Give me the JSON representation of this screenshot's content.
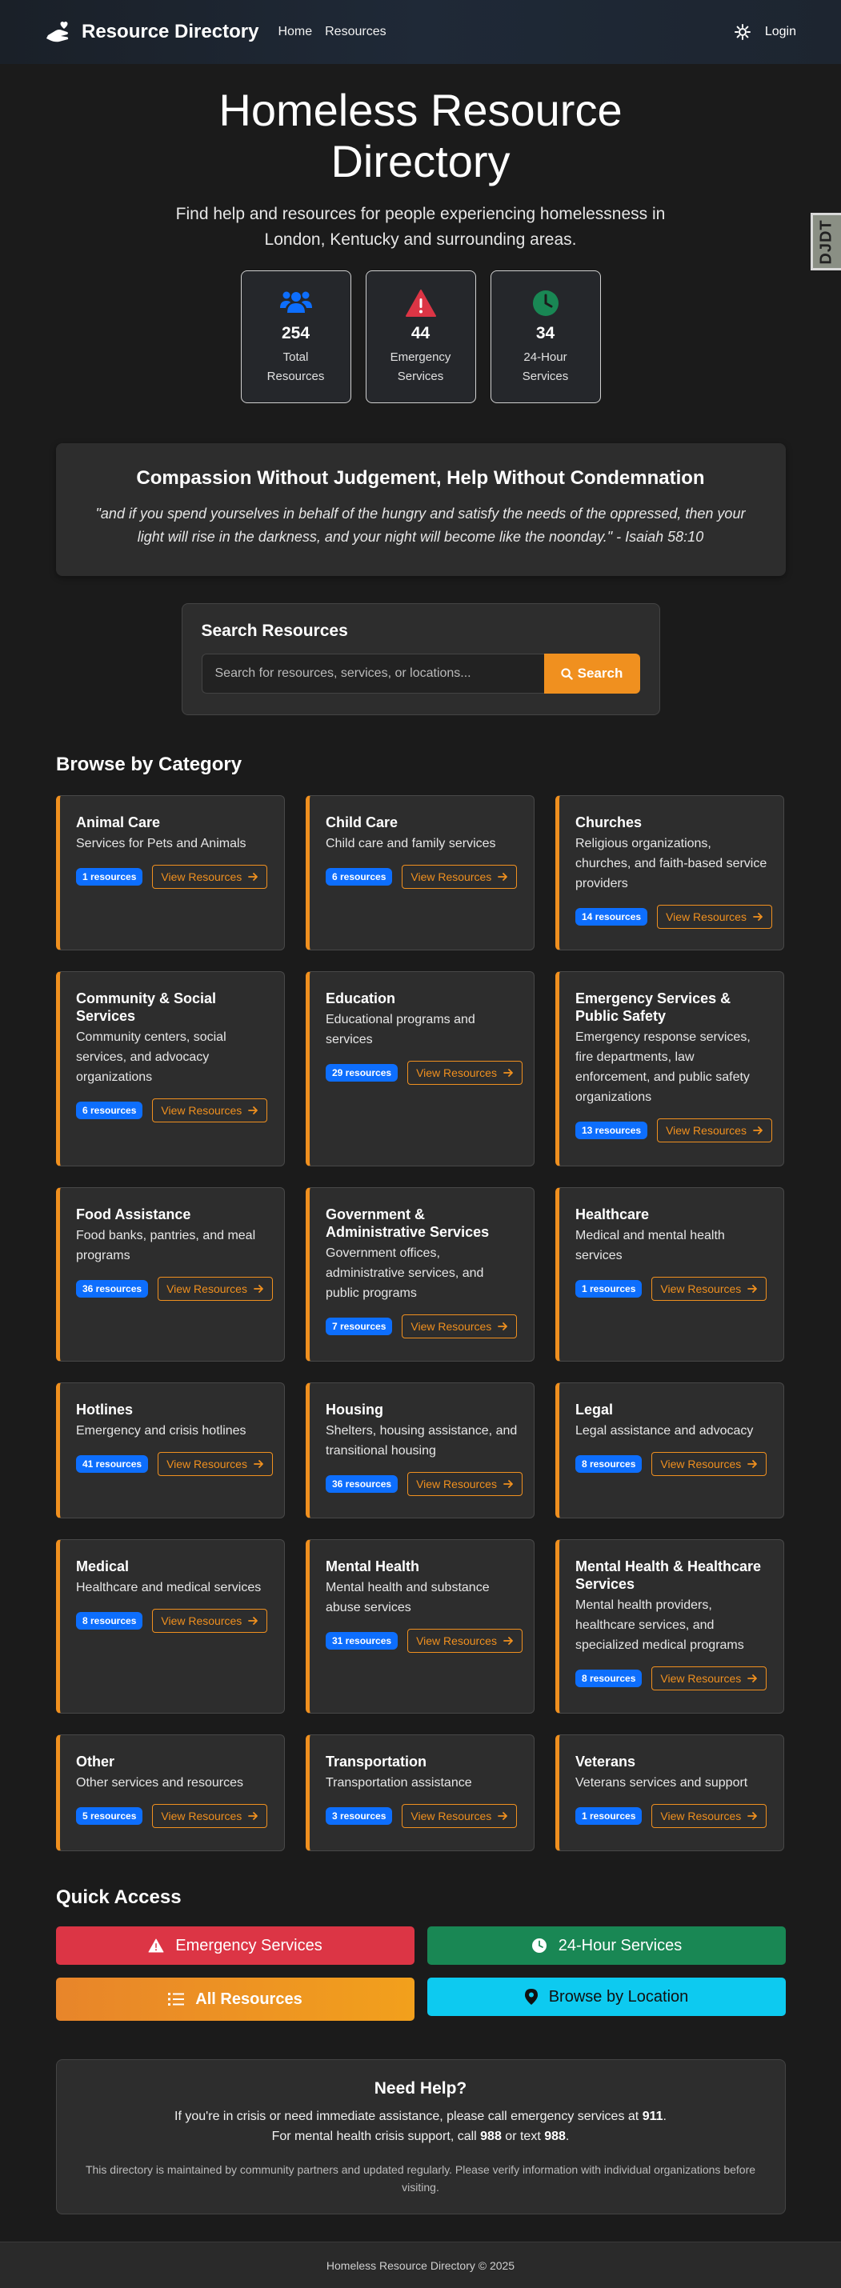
{
  "nav": {
    "brand": "Resource Directory",
    "links": [
      "Home",
      "Resources"
    ],
    "login": "Login"
  },
  "side_widget": {
    "label": "DJDT"
  },
  "hero": {
    "title": "Homeless Resource Directory",
    "lead": "Find help and resources for people experiencing homelessness in London, Kentucky and surrounding areas.",
    "stats": [
      {
        "icon": "users-icon",
        "value": "254",
        "label": "Total Resources",
        "color": "#0d6efd"
      },
      {
        "icon": "warning-icon",
        "value": "44",
        "label": "Emergency Services",
        "color": "#dc3545"
      },
      {
        "icon": "clock-icon",
        "value": "34",
        "label": "24-Hour Services",
        "color": "#198754"
      }
    ]
  },
  "quote": {
    "title": "Compassion Without Judgement, Help Without Condemnation",
    "text": "\"and if you spend yourselves in behalf of the hungry and satisfy the needs of the oppressed, then your light will rise in the darkness, and your night will become like the noonday.\" - Isaiah 58:10"
  },
  "search": {
    "title": "Search Resources",
    "placeholder": "Search for resources, services, or locations...",
    "button": "Search"
  },
  "browse": {
    "title": "Browse by Category",
    "view_label": "View Resources",
    "categories": [
      {
        "title": "Animal Care",
        "desc": "Services for Pets and Animals",
        "count": "1 resources"
      },
      {
        "title": "Child Care",
        "desc": "Child care and family services",
        "count": "6 resources"
      },
      {
        "title": "Churches",
        "desc": "Religious organizations, churches, and faith-based service providers",
        "count": "14 resources"
      },
      {
        "title": "Community & Social Services",
        "desc": "Community centers, social services, and advocacy organizations",
        "count": "6 resources"
      },
      {
        "title": "Education",
        "desc": "Educational programs and services",
        "count": "29 resources"
      },
      {
        "title": "Emergency Services & Public Safety",
        "desc": "Emergency response services, fire departments, law enforcement, and public safety organizations",
        "count": "13 resources"
      },
      {
        "title": "Food Assistance",
        "desc": "Food banks, pantries, and meal programs",
        "count": "36 resources"
      },
      {
        "title": "Government & Administrative Services",
        "desc": "Government offices, administrative services, and public programs",
        "count": "7 resources"
      },
      {
        "title": "Healthcare",
        "desc": "Medical and mental health services",
        "count": "1 resources"
      },
      {
        "title": "Hotlines",
        "desc": "Emergency and crisis hotlines",
        "count": "41 resources"
      },
      {
        "title": "Housing",
        "desc": "Shelters, housing assistance, and transitional housing",
        "count": "36 resources"
      },
      {
        "title": "Legal",
        "desc": "Legal assistance and advocacy",
        "count": "8 resources"
      },
      {
        "title": "Medical",
        "desc": "Healthcare and medical services",
        "count": "8 resources"
      },
      {
        "title": "Mental Health",
        "desc": "Mental health and substance abuse services",
        "count": "31 resources"
      },
      {
        "title": "Mental Health & Healthcare Services",
        "desc": "Mental health providers, healthcare services, and specialized medical programs",
        "count": "8 resources"
      },
      {
        "title": "Other",
        "desc": "Other services and resources",
        "count": "5 resources"
      },
      {
        "title": "Transportation",
        "desc": "Transportation assistance",
        "count": "3 resources"
      },
      {
        "title": "Veterans",
        "desc": "Veterans services and support",
        "count": "1 resources"
      }
    ]
  },
  "quick": {
    "title": "Quick Access",
    "emergency": "Emergency Services",
    "hours24": "24-Hour Services",
    "all": "All Resources",
    "location": "Browse by Location"
  },
  "help": {
    "title": "Need Help?",
    "line1_pre": "If you're in crisis or need immediate assistance, please call emergency services at ",
    "line1_num": "911",
    "line1_post": ".",
    "line2_pre": "For mental health crisis support, call ",
    "line2_num1": "988",
    "line2_mid": " or text ",
    "line2_num2": "988",
    "line2_post": ".",
    "note": "This directory is maintained by community partners and updated regularly. Please verify information with individual organizations before visiting."
  },
  "footer": {
    "text": "Homeless Resource Directory © 2025"
  },
  "colors": {
    "accent": "#f0901f",
    "badge": "#0d6efd",
    "danger": "#dc3545",
    "success": "#198754",
    "info": "#0dcaf0"
  }
}
